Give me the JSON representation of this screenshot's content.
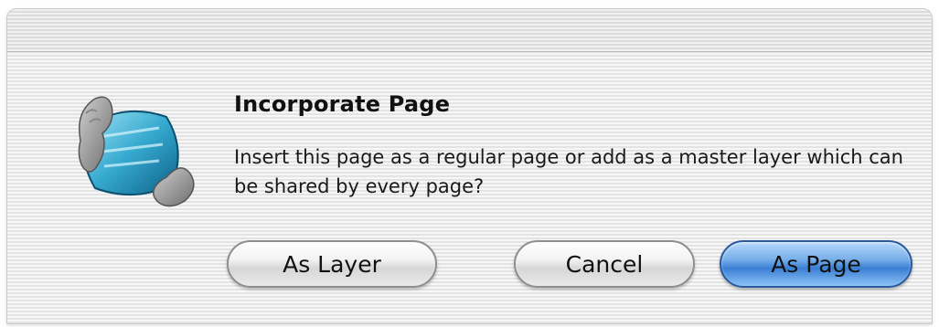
{
  "dialog": {
    "title": "Incorporate Page",
    "message": "Insert this page as a regular page or add as a master layer which can be shared by every page?",
    "icon": "application-icon"
  },
  "buttons": {
    "as_layer": "As Layer",
    "cancel": "Cancel",
    "as_page": "As Page"
  },
  "colors": {
    "default_button": "#5a9be6",
    "dialog_background": "#ececec"
  }
}
